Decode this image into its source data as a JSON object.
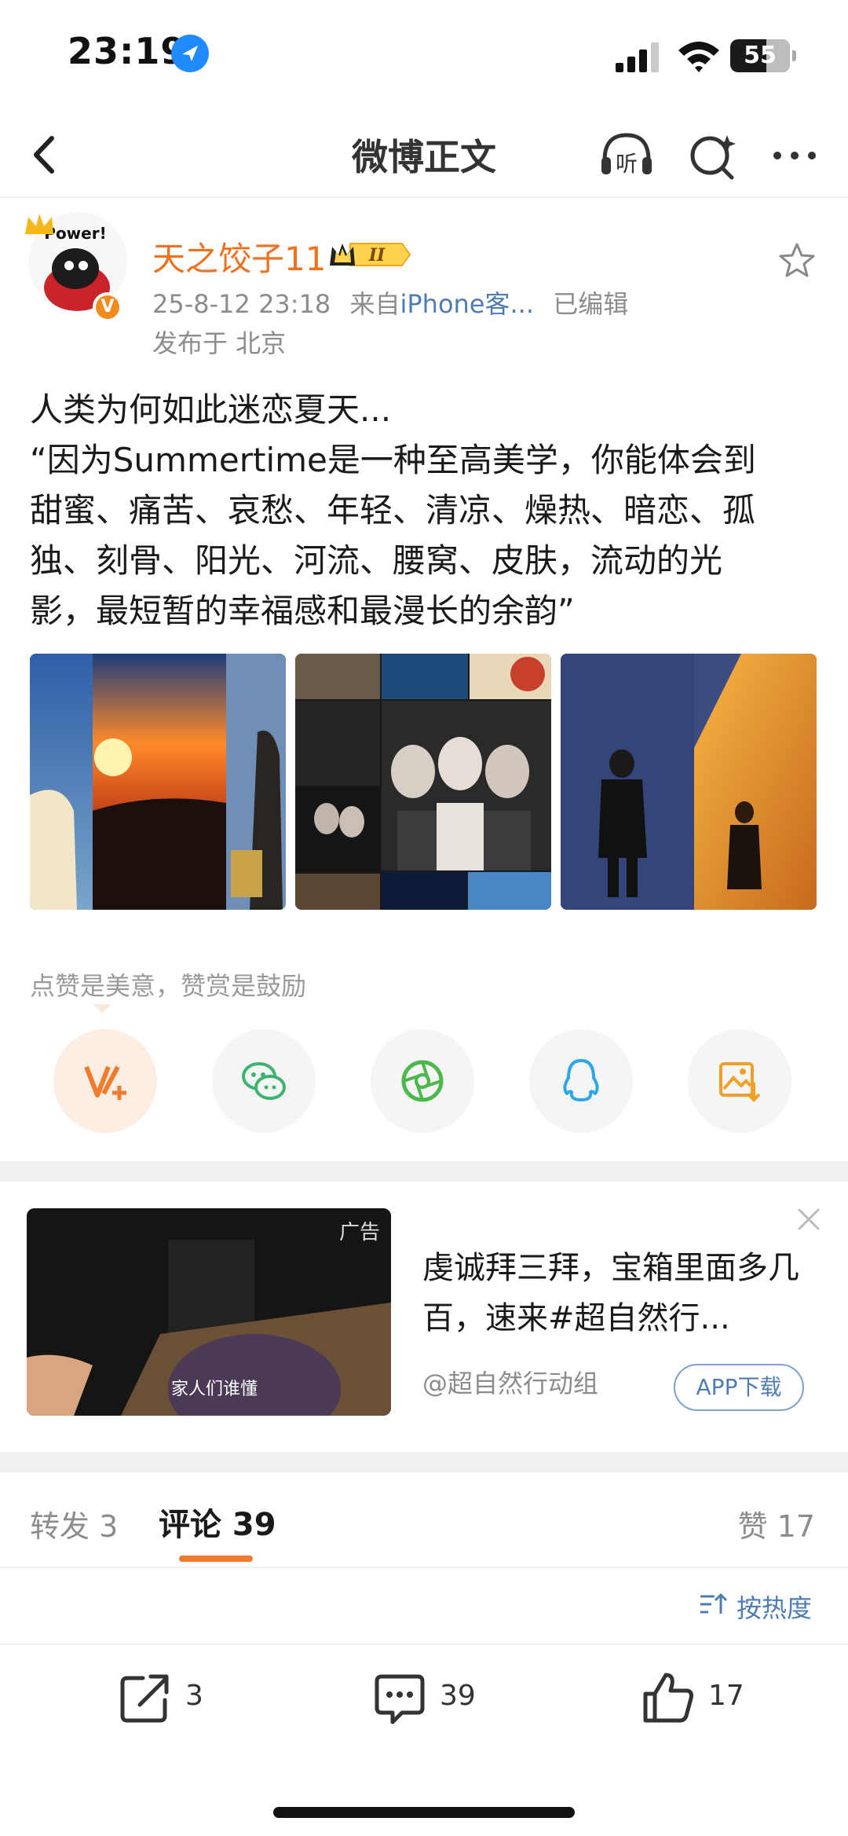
{
  "status_bar": {
    "time": "23:19",
    "battery": "55"
  },
  "nav": {
    "title": "微博正文",
    "listen_label": "听"
  },
  "post": {
    "author": "天之饺子11",
    "vip_level": "II",
    "avatar_text": "Power!",
    "verified_badge": "V",
    "timestamp": "25-8-12 23:18",
    "source_prefix": "来自",
    "source": "iPhone客...",
    "edited": "已编辑",
    "location": "发布于 北京",
    "text_lines": [
      "人类为何如此迷恋夏天...",
      "“因为Summertime是一种至高美学，你能体会到",
      "甜蜜、痛苦、哀愁、年轻、清凉、燥热、暗恋、孤",
      "独、刻骨、阳光、河流、腰窝、皮肤，流动的光",
      "影，最短暂的幸福感和最漫长的余韵”"
    ],
    "tip_hint": "点赞是美意，赞赏是鼓励"
  },
  "ad": {
    "tag": "广告",
    "caption": "家人们谁懂",
    "title": "虔诚拜三拜，宝箱里面多几百，速来#超自然行...",
    "source": "@超自然行动组",
    "download": "APP下载"
  },
  "tabs": {
    "repost": "转发 3",
    "comment": "评论 39",
    "like": "赞 17"
  },
  "sort": {
    "label": "按热度"
  },
  "actions": {
    "repost": "3",
    "comment": "39",
    "like": "17"
  },
  "colors": {
    "accent_orange": "#f0711d",
    "link_blue": "#4f7cb3"
  }
}
